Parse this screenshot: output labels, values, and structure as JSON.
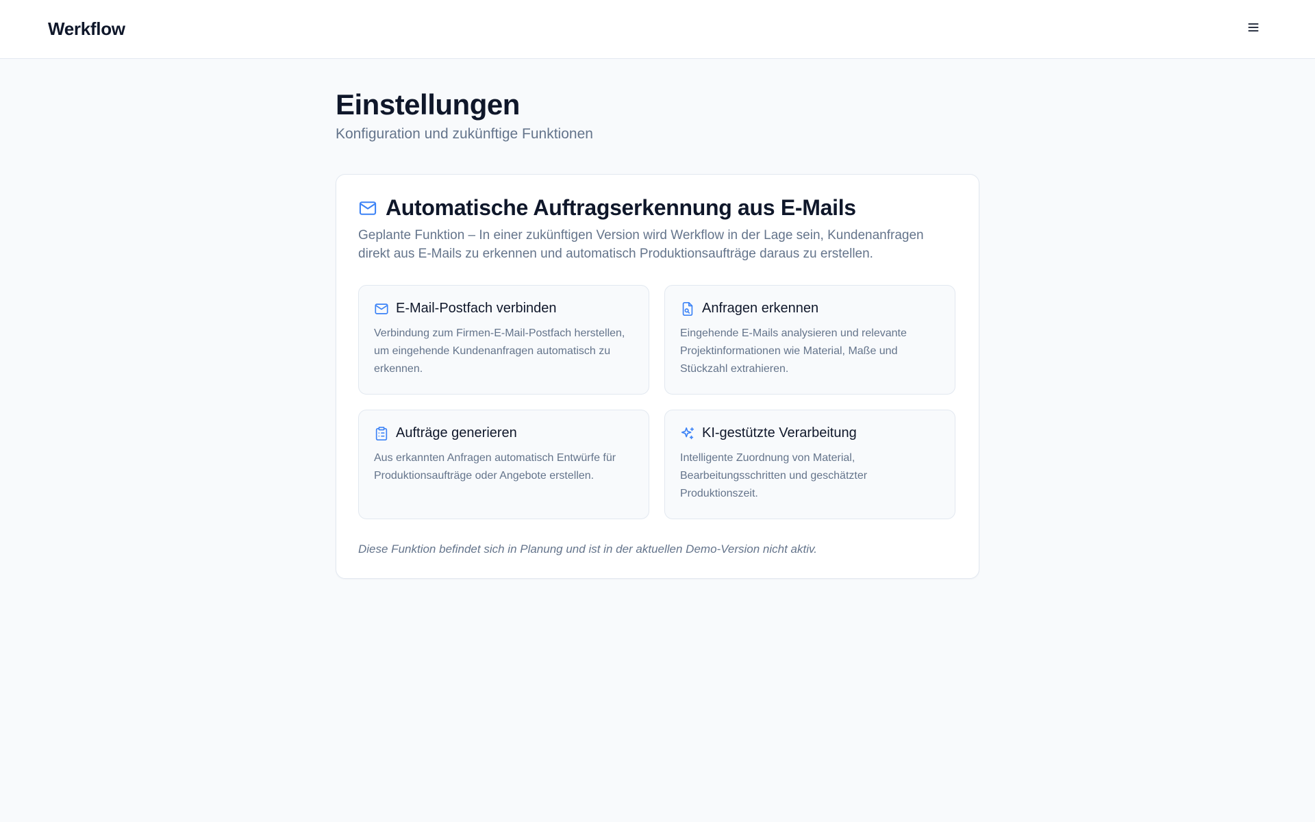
{
  "header": {
    "brand": "Werkflow",
    "menu_icon": "menu-icon"
  },
  "page": {
    "title": "Einstellungen",
    "subtitle": "Konfiguration und zukünftige Funktionen"
  },
  "card": {
    "icon": "mail-icon",
    "title": "Automatische Auftragserkennung aus E-Mails",
    "description": "Geplante Funktion – In einer zukünftigen Version wird Werkflow in der Lage sein, Kundenanfragen direkt aus E-Mails zu erkennen und automatisch Produktionsaufträge daraus zu erstellen.",
    "features": [
      {
        "icon": "mail-icon",
        "title": "E-Mail-Postfach verbinden",
        "description": "Verbindung zum Firmen-E-Mail-Postfach herstellen, um eingehende Kundenanfragen automatisch zu erkennen."
      },
      {
        "icon": "file-search-icon",
        "title": "Anfragen erkennen",
        "description": "Eingehende E-Mails analysieren und relevante Projektinformationen wie Material, Maße und Stückzahl extrahieren."
      },
      {
        "icon": "clipboard-list-icon",
        "title": "Aufträge generieren",
        "description": "Aus erkannten Anfragen automatisch Entwürfe für Produktionsaufträge oder Angebote erstellen."
      },
      {
        "icon": "sparkles-icon",
        "title": "KI-gestützte Verarbeitung",
        "description": "Intelligente Zuordnung von Material, Bearbeitungsschritten und geschätzter Produktionszeit."
      }
    ],
    "note": "Diese Funktion befindet sich in Planung und ist in der aktuellen Demo-Version nicht aktiv."
  },
  "colors": {
    "accent": "#3b82f6",
    "background": "#f8fafc",
    "text": "#0f172a",
    "muted": "#64748b",
    "border": "#e2e8f0"
  }
}
